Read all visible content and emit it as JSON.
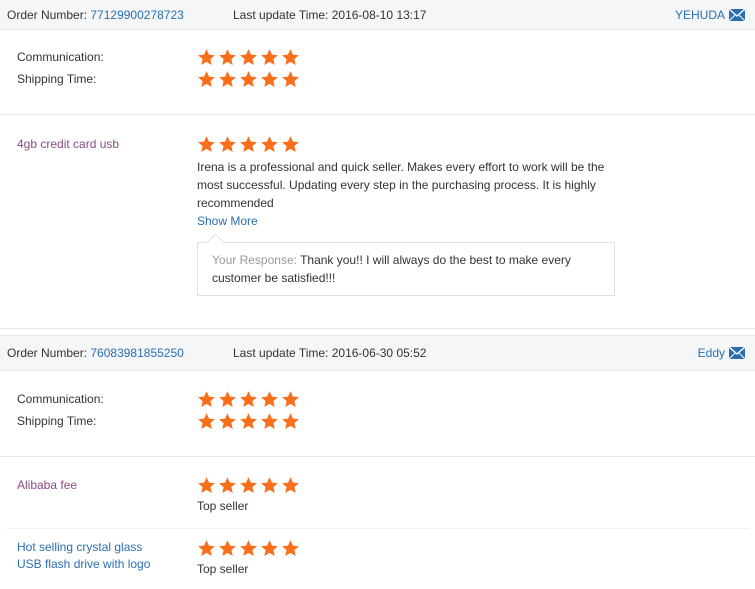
{
  "orders": [
    {
      "label": "Order Number:",
      "number": "77129900278723",
      "update": "Last update Time: 2016-08-10 13:17",
      "buyer": "YEHUDA",
      "communication": "Communication:",
      "shipping": "Shipping Time:",
      "communication_rating": 5,
      "shipping_rating": 5,
      "product": "4gb credit card usb",
      "product_rating": 5,
      "review_lines": [
        "Irena is a professional and quick seller. Makes every effort to work will be the",
        "most successful. Updating every step in the purchasing process. It is highly",
        "recommended"
      ],
      "show_more": "Show More",
      "response_label": "Your Response:",
      "response_text_1": " Thank you!! I will always do the best to make every",
      "response_text_2": "customer be satisfied!!!"
    },
    {
      "label": "Order Number:",
      "number": "76083981855250",
      "update": "Last update Time: 2016-06-30 05:52",
      "buyer": "Eddy",
      "communication": "Communication:",
      "shipping": "Shipping Time:",
      "communication_rating": 5,
      "shipping_rating": 5,
      "products": [
        {
          "name": "Alibaba fee",
          "rating": 5,
          "comment": "Top seller"
        },
        {
          "name_line1": "Hot selling crystal glass",
          "name_line2": "USB flash drive with logo",
          "rating": 5,
          "comment": "Top seller"
        }
      ]
    }
  ],
  "colors": {
    "star": "#f86e1b",
    "link": "#2a6fb0",
    "product_purple": "#8b4a8a"
  },
  "icons": {
    "mail": "mail-icon",
    "star": "star-icon"
  }
}
